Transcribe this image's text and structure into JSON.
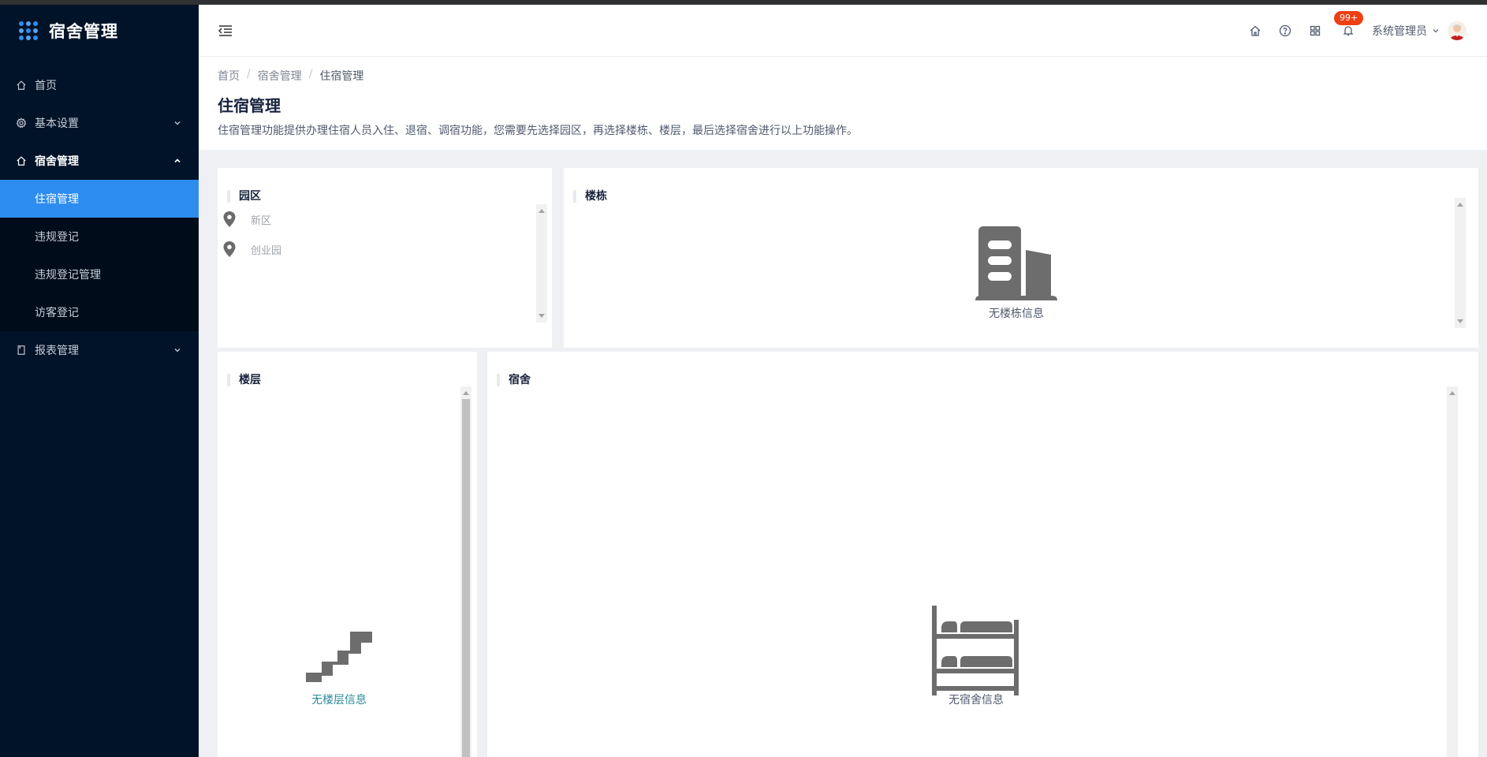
{
  "app": {
    "title": "宿舍管理"
  },
  "sidebar": {
    "items": [
      {
        "label": "首页",
        "icon": "home-icon"
      },
      {
        "label": "基本设置",
        "icon": "gear-icon"
      },
      {
        "label": "宿舍管理",
        "icon": "home-icon"
      },
      {
        "label": "报表管理",
        "icon": "document-icon"
      }
    ],
    "submenu": [
      {
        "label": "住宿管理",
        "active": true
      },
      {
        "label": "违规登记"
      },
      {
        "label": "违规登记管理"
      },
      {
        "label": "访客登记"
      }
    ]
  },
  "header": {
    "notification_count": "99+",
    "user_name": "系统管理员"
  },
  "breadcrumb": [
    "首页",
    "宿舍管理",
    "住宿管理"
  ],
  "page": {
    "title": "住宿管理",
    "description": "住宿管理功能提供办理住宿人员入住、退宿、调宿功能，您需要先选择园区，再选择楼栋、楼层，最后选择宿舍进行以上功能操作。"
  },
  "panels": {
    "park": {
      "title": "园区",
      "items": [
        "新区",
        "创业园"
      ]
    },
    "building": {
      "title": "楼栋",
      "empty_text": "无楼栋信息"
    },
    "floor": {
      "title": "楼层",
      "empty_text": "无楼层信息"
    },
    "dorm": {
      "title": "宿舍",
      "empty_text": "无宿舍信息"
    }
  },
  "colors": {
    "sidebar_bg": "#011328",
    "accent": "#2d8cf0",
    "badge": "#ed4014",
    "floor_empty_text": "#2b8a9a"
  }
}
